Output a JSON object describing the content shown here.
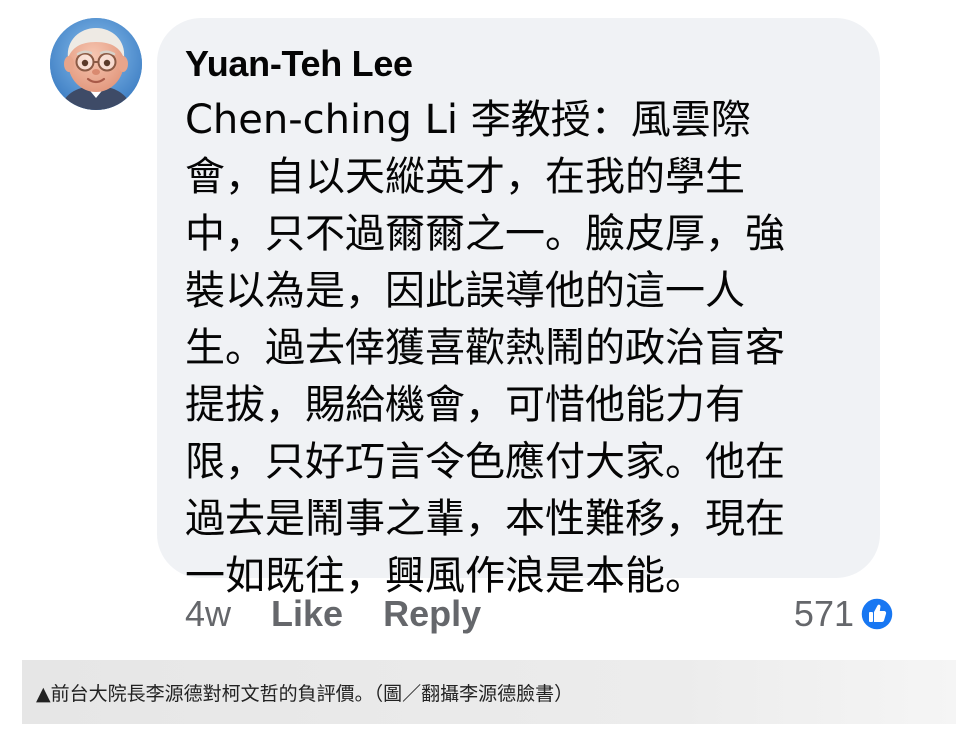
{
  "comment": {
    "author": "Yuan-Teh Lee",
    "avatar_icon": "cartoon-elderly-man-avatar",
    "body_lines": [
      "Chen-ching Li 李教授：風雲際",
      "會，自以天縱英才，在我的學生",
      "中，只不過爾爾之一。臉皮厚，強",
      "裝以為是，因此誤導他的這一人",
      "生。過去倖獲喜歡熱鬧的政治盲客",
      "提拔，賜給機會，可惜他能力有",
      "限，只好巧言令色應付大家。他在",
      "過去是鬧事之輩，本性難移，現在",
      "一如既往，興風作浪是本能。"
    ],
    "time": "4w",
    "like_label": "Like",
    "reply_label": "Reply",
    "reaction_count": "571",
    "reaction_icon": "like-thumbs-up-icon"
  },
  "caption": {
    "text": "▲前台大院長李源德對柯文哲的負評價。（圖／翻攝李源德臉書）"
  },
  "colors": {
    "bubble_bg": "#f0f2f5",
    "meta_text": "#65676b",
    "like_blue": "#1877f2",
    "caption_bg": "#e6e6e6"
  }
}
